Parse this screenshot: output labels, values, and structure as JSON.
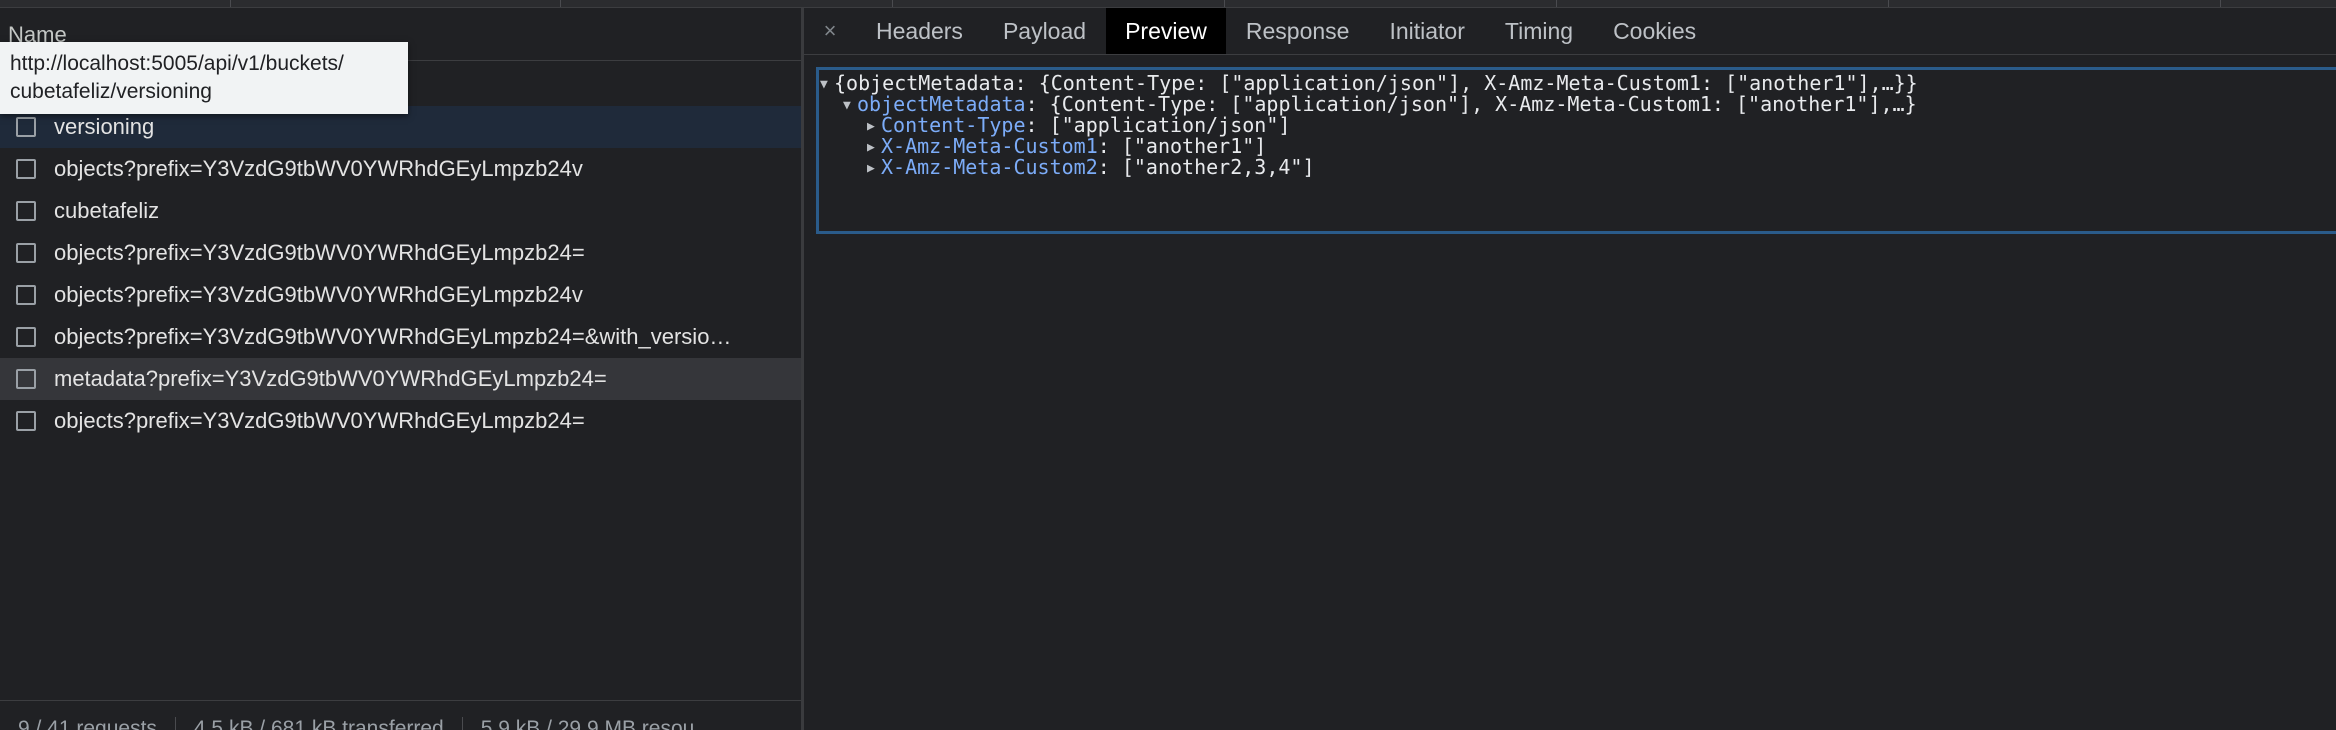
{
  "left_panel": {
    "column_header": "Name",
    "tooltip_lines": [
      "http://localhost:5005/api/v1/buckets/",
      "cubetafeliz/versioning"
    ],
    "requests": [
      {
        "name": "versioning",
        "state": "selected"
      },
      {
        "name": "objects?prefix=Y3VzdG9tbWV0YWRhdGEyLmpzb24v",
        "state": ""
      },
      {
        "name": "cubetafeliz",
        "state": ""
      },
      {
        "name": "objects?prefix=Y3VzdG9tbWV0YWRhdGEyLmpzb24=",
        "state": ""
      },
      {
        "name": "objects?prefix=Y3VzdG9tbWV0YWRhdGEyLmpzb24v",
        "state": ""
      },
      {
        "name": "objects?prefix=Y3VzdG9tbWV0YWRhdGEyLmpzb24=&with_versio…",
        "state": ""
      },
      {
        "name": "metadata?prefix=Y3VzdG9tbWV0YWRhdGEyLmpzb24=",
        "state": "hovered"
      },
      {
        "name": "objects?prefix=Y3VzdG9tbWV0YWRhdGEyLmpzb24=",
        "state": ""
      }
    ],
    "status": {
      "requests": "9 / 41 requests",
      "transferred": "4.5 kB / 681 kB transferred",
      "resources": "5.9 kB / 29.9 MB resou"
    }
  },
  "right_panel": {
    "close_label": "×",
    "tabs": [
      "Headers",
      "Payload",
      "Preview",
      "Response",
      "Initiator",
      "Timing",
      "Cookies"
    ],
    "active_tab": "Preview",
    "preview": {
      "root_line": "{objectMetadata: {Content-Type: [\"application/json\"], X-Amz-Meta-Custom1: [\"another1\"],…}}",
      "object_key": "objectMetadata",
      "object_summary": ": {Content-Type: [\"application/json\"], X-Amz-Meta-Custom1: [\"another1\"],…}",
      "entries": [
        {
          "key": "Content-Type",
          "value": ": [\"application/json\"]"
        },
        {
          "key": "X-Amz-Meta-Custom1",
          "value": ": [\"another1\"]"
        },
        {
          "key": "X-Amz-Meta-Custom2",
          "value": ": [\"another2,3,4\"]"
        }
      ]
    }
  },
  "icons": {
    "expanded": "▼",
    "collapsed": "▶"
  }
}
